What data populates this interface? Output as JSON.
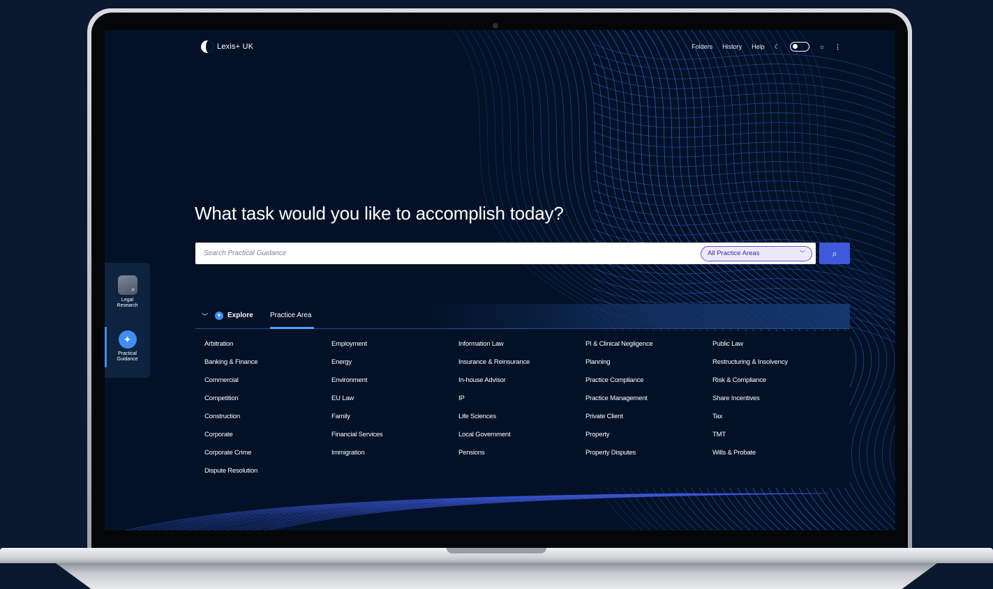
{
  "app": {
    "logo_text": "Lexis+ UK"
  },
  "topnav": {
    "folders": "Folders",
    "history": "History",
    "help": "Help"
  },
  "rail": [
    {
      "label_line1": "Legal",
      "label_line2": "Research"
    },
    {
      "label_line1": "Practical",
      "label_line2": "Guidance"
    }
  ],
  "hero": {
    "title": "What task would you like to accomplish today?"
  },
  "search": {
    "placeholder": "Search Practical Guidance",
    "filter_selected": "All Practice Areas"
  },
  "explore": {
    "label": "Explore",
    "tab": "Practice Area"
  },
  "practice_areas": [
    "Arbitration",
    "Banking & Finance",
    "Commercial",
    "Competition",
    "Construction",
    "Corporate",
    "Corporate Crime",
    "Dispute Resolution",
    "Employment",
    "Energy",
    "Environment",
    "EU Law",
    "Family",
    "Financial Services",
    "Immigration",
    "Information Law",
    "Insurance & Reinsurance",
    "In-house Advisor",
    "IP",
    "Life Sciences",
    "Local Government",
    "Pensions",
    "PI & Clinical Negligence",
    "Planning",
    "Practice Compliance",
    "Practice Management",
    "Private Client",
    "Property",
    "Property Disputes",
    "Public Law",
    "Restructuring & Insolvency",
    "Risk & Compliance",
    "Share Incentives",
    "Tax",
    "TMT",
    "Wills & Probate"
  ],
  "columns": [
    8,
    7,
    7,
    7,
    7
  ],
  "colors": {
    "background": "#021126",
    "accent": "#3e59d9",
    "wave": "#2f6fe8",
    "select_border": "#6a4fd6"
  }
}
